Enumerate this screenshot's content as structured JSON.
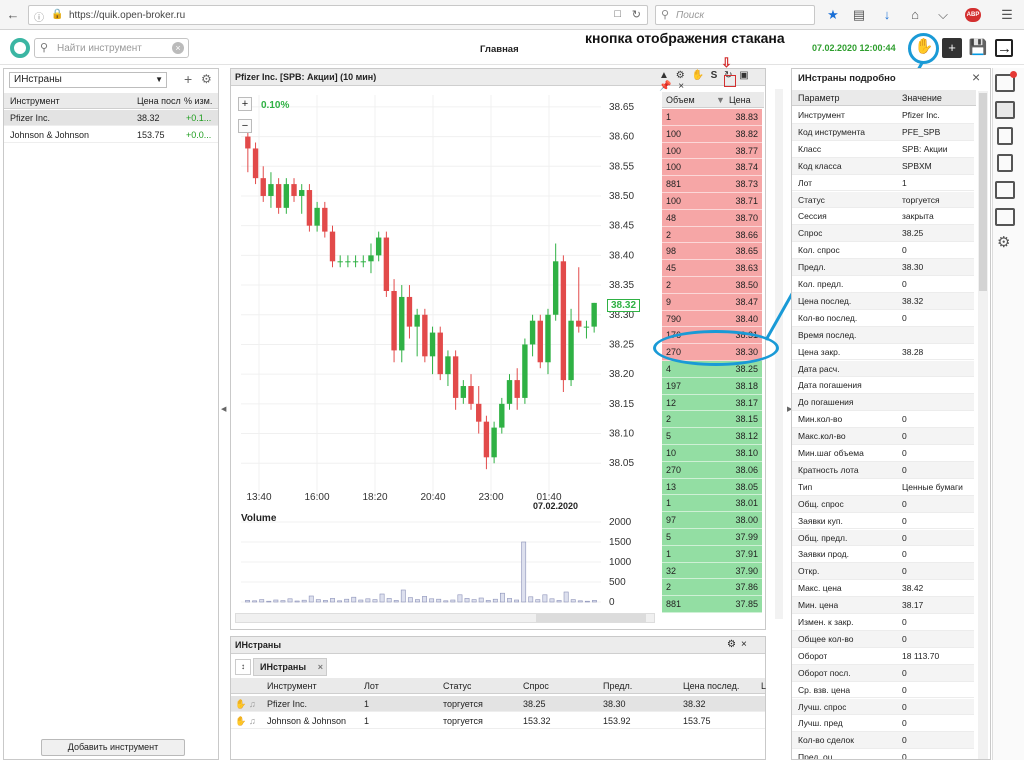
{
  "browser": {
    "url": "https://quik.open-broker.ru",
    "search_placeholder": "Поиск"
  },
  "header": {
    "search_placeholder": "Найти инструмент",
    "page_title": "Главная",
    "annotation": "кнопка отображения стакана",
    "datetime": "07.02.2020 12:00:44"
  },
  "left_panel": {
    "list_name": "ИНстраны",
    "columns": [
      "Инструмент",
      "Цена посл",
      "% изм."
    ],
    "rows": [
      {
        "name": "Pfizer Inc.",
        "price": "38.32",
        "change": "+0.1..."
      },
      {
        "name": "Johnson & Johnson",
        "price": "153.75",
        "change": "+0.0..."
      }
    ],
    "add_button": "Добавить инструмент"
  },
  "chart_panel": {
    "title": "Pfizer Inc. [SPB: Акции] (10 мин)",
    "change_pct": "0.10%",
    "current_price": "38.32",
    "volume_label": "Volume",
    "date_label": "07.02.2020"
  },
  "chart_data": [
    {
      "type": "candlestick",
      "title": "Pfizer Inc. [SPB: Акции] (10 мин)",
      "xlabel": "",
      "ylabel": "",
      "y_ticks": [
        "38.65",
        "38.60",
        "38.55",
        "38.50",
        "38.45",
        "38.40",
        "38.35",
        "38.30",
        "38.25",
        "38.20",
        "38.15",
        "38.10",
        "38.05"
      ],
      "x_ticks": [
        "13:40",
        "16:00",
        "18:20",
        "20:40",
        "23:00",
        "01:40"
      ],
      "ylim": [
        38.01,
        38.67
      ],
      "colors": {
        "up": "#2fb144",
        "down": "#e24a4a"
      },
      "candles": [
        [
          38.6,
          38.62,
          38.54,
          38.58
        ],
        [
          38.58,
          38.59,
          38.52,
          38.53
        ],
        [
          38.53,
          38.55,
          38.49,
          38.5
        ],
        [
          38.5,
          38.54,
          38.48,
          38.52
        ],
        [
          38.52,
          38.53,
          38.47,
          38.48
        ],
        [
          38.48,
          38.53,
          38.47,
          38.52
        ],
        [
          38.52,
          38.53,
          38.49,
          38.5
        ],
        [
          38.5,
          38.52,
          38.47,
          38.51
        ],
        [
          38.51,
          38.52,
          38.44,
          38.45
        ],
        [
          38.45,
          38.49,
          38.44,
          38.48
        ],
        [
          38.48,
          38.49,
          38.43,
          38.44
        ],
        [
          38.44,
          38.45,
          38.38,
          38.39
        ],
        [
          38.39,
          38.4,
          38.38,
          38.39
        ],
        [
          38.39,
          38.4,
          38.38,
          38.39
        ],
        [
          38.39,
          38.4,
          38.38,
          38.39
        ],
        [
          38.39,
          38.4,
          38.38,
          38.39
        ],
        [
          38.39,
          38.42,
          38.37,
          38.4
        ],
        [
          38.4,
          38.44,
          38.39,
          38.43
        ],
        [
          38.43,
          38.44,
          38.33,
          38.34
        ],
        [
          38.34,
          38.36,
          38.22,
          38.24
        ],
        [
          38.24,
          38.35,
          38.22,
          38.33
        ],
        [
          38.33,
          38.35,
          38.26,
          38.28
        ],
        [
          38.28,
          38.31,
          38.23,
          38.3
        ],
        [
          38.3,
          38.31,
          38.22,
          38.23
        ],
        [
          38.23,
          38.28,
          38.2,
          38.27
        ],
        [
          38.27,
          38.28,
          38.19,
          38.2
        ],
        [
          38.2,
          38.24,
          38.18,
          38.23
        ],
        [
          38.23,
          38.24,
          38.14,
          38.16
        ],
        [
          38.16,
          38.19,
          38.15,
          38.18
        ],
        [
          38.18,
          38.2,
          38.14,
          38.15
        ],
        [
          38.15,
          38.18,
          38.1,
          38.12
        ],
        [
          38.12,
          38.13,
          38.04,
          38.06
        ],
        [
          38.06,
          38.12,
          38.05,
          38.11
        ],
        [
          38.11,
          38.16,
          38.1,
          38.15
        ],
        [
          38.15,
          38.2,
          38.14,
          38.19
        ],
        [
          38.19,
          38.21,
          38.14,
          38.16
        ],
        [
          38.16,
          38.26,
          38.15,
          38.25
        ],
        [
          38.25,
          38.3,
          38.23,
          38.29
        ],
        [
          38.29,
          38.3,
          38.21,
          38.22
        ],
        [
          38.22,
          38.31,
          38.2,
          38.3
        ],
        [
          38.3,
          38.42,
          38.29,
          38.39
        ],
        [
          38.39,
          38.4,
          38.17,
          38.19
        ],
        [
          38.19,
          38.31,
          38.18,
          38.29
        ],
        [
          38.29,
          38.38,
          38.27,
          38.28
        ],
        [
          38.28,
          38.29,
          38.26,
          38.28
        ],
        [
          38.28,
          38.32,
          38.27,
          38.32
        ]
      ]
    },
    {
      "type": "bar",
      "title": "Volume",
      "y_ticks": [
        "2000",
        "1500",
        "1000",
        "500",
        "0"
      ],
      "ylim": [
        0,
        2000
      ],
      "values": [
        40,
        30,
        60,
        20,
        50,
        35,
        80,
        25,
        45,
        150,
        60,
        40,
        90,
        30,
        70,
        120,
        50,
        80,
        60,
        200,
        90,
        40,
        300,
        110,
        60,
        140,
        80,
        70,
        30,
        50,
        180,
        90,
        60,
        100,
        40,
        70,
        220,
        90,
        50,
        1500,
        130,
        60,
        180,
        80,
        40,
        250,
        60,
        30,
        20,
        40
      ]
    }
  ],
  "orderbook": {
    "col_volume": "Объем",
    "col_price": "Цена",
    "rows": [
      {
        "v": "1",
        "p": "38.83",
        "side": "sell"
      },
      {
        "v": "100",
        "p": "38.82",
        "side": "sell"
      },
      {
        "v": "100",
        "p": "38.77",
        "side": "sell"
      },
      {
        "v": "100",
        "p": "38.74",
        "side": "sell"
      },
      {
        "v": "881",
        "p": "38.73",
        "side": "sell"
      },
      {
        "v": "100",
        "p": "38.71",
        "side": "sell"
      },
      {
        "v": "48",
        "p": "38.70",
        "side": "sell"
      },
      {
        "v": "2",
        "p": "38.66",
        "side": "sell"
      },
      {
        "v": "98",
        "p": "38.65",
        "side": "sell"
      },
      {
        "v": "45",
        "p": "38.63",
        "side": "sell"
      },
      {
        "v": "2",
        "p": "38.50",
        "side": "sell"
      },
      {
        "v": "9",
        "p": "38.47",
        "side": "sell"
      },
      {
        "v": "790",
        "p": "38.40",
        "side": "sell"
      },
      {
        "v": "176",
        "p": "38.31",
        "side": "sell"
      },
      {
        "v": "270",
        "p": "38.30",
        "side": "sell"
      },
      {
        "v": "4",
        "p": "38.25",
        "side": "buy"
      },
      {
        "v": "197",
        "p": "38.18",
        "side": "buy"
      },
      {
        "v": "12",
        "p": "38.17",
        "side": "buy"
      },
      {
        "v": "2",
        "p": "38.15",
        "side": "buy"
      },
      {
        "v": "5",
        "p": "38.12",
        "side": "buy"
      },
      {
        "v": "10",
        "p": "38.10",
        "side": "buy"
      },
      {
        "v": "270",
        "p": "38.06",
        "side": "buy"
      },
      {
        "v": "13",
        "p": "38.05",
        "side": "buy"
      },
      {
        "v": "1",
        "p": "38.01",
        "side": "buy"
      },
      {
        "v": "97",
        "p": "38.00",
        "side": "buy"
      },
      {
        "v": "5",
        "p": "37.99",
        "side": "buy"
      },
      {
        "v": "1",
        "p": "37.91",
        "side": "buy"
      },
      {
        "v": "32",
        "p": "37.90",
        "side": "buy"
      },
      {
        "v": "2",
        "p": "37.86",
        "side": "buy"
      },
      {
        "v": "881",
        "p": "37.85",
        "side": "buy"
      }
    ]
  },
  "bottom_panel": {
    "title": "ИНстраны",
    "tab": "ИНстраны",
    "columns": [
      "Инструмент",
      "Лот",
      "Статус",
      "Спрос",
      "Предл.",
      "Цена послед.",
      "L"
    ],
    "rows": [
      [
        "Pfizer Inc.",
        "1",
        "торгуется",
        "38.25",
        "38.30",
        "38.32"
      ],
      [
        "Johnson & Johnson",
        "1",
        "торгуется",
        "153.32",
        "153.92",
        "153.75"
      ]
    ]
  },
  "right_panel": {
    "title": "ИНстраны подробно",
    "col_param": "Параметр",
    "col_value": "Значение",
    "rows": [
      [
        "Инструмент",
        "Pfizer Inc."
      ],
      [
        "Код инструмента",
        "PFE_SPB"
      ],
      [
        "Класс",
        "SPB: Акции"
      ],
      [
        "Код класса",
        "SPBXM"
      ],
      [
        "Лот",
        "1"
      ],
      [
        "Статус",
        "торгуется"
      ],
      [
        "Сессия",
        "закрыта"
      ],
      [
        "Спрос",
        "38.25"
      ],
      [
        "Кол. спрос",
        "0"
      ],
      [
        "Предл.",
        "38.30"
      ],
      [
        "Кол. предл.",
        "0"
      ],
      [
        "Цена послед.",
        "38.32"
      ],
      [
        "Кол-во послед.",
        "0"
      ],
      [
        "Время послед.",
        ""
      ],
      [
        "Цена закр.",
        "38.28"
      ],
      [
        "Дата расч.",
        ""
      ],
      [
        "Дата погашения",
        ""
      ],
      [
        "До погашения",
        ""
      ],
      [
        "Мин.кол-во",
        "0"
      ],
      [
        "Макс.кол-во",
        "0"
      ],
      [
        "Мин.шаг объема",
        "0"
      ],
      [
        "Кратность лота",
        "0"
      ],
      [
        "Тип",
        "Ценные бумаги"
      ],
      [
        "Общ. спрос",
        "0"
      ],
      [
        "Заявки куп.",
        "0"
      ],
      [
        "Общ. предл.",
        "0"
      ],
      [
        "Заявки прод.",
        "0"
      ],
      [
        "Откр.",
        "0"
      ],
      [
        "Макс. цена",
        "38.42"
      ],
      [
        "Мин. цена",
        "38.17"
      ],
      [
        "Измен. к закр.",
        "0"
      ],
      [
        "Общее кол-во",
        "0"
      ],
      [
        "Оборот",
        "18 113.70"
      ],
      [
        "Оборот посл.",
        "0"
      ],
      [
        "Ср. взв. цена",
        "0"
      ],
      [
        "Лучш. спрос",
        "0"
      ],
      [
        "Лучш. пред",
        "0"
      ],
      [
        "Кол-во сделок",
        "0"
      ],
      [
        "Пред. оц.",
        "0"
      ]
    ]
  },
  "colors": {
    "sell": "#f6a6a6",
    "buy": "#93dea3",
    "annotation": "#1a9ad6",
    "accent_green": "#2fb144"
  }
}
